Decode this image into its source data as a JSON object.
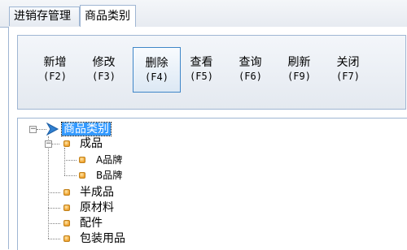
{
  "tabs": [
    {
      "label": "进销存管理",
      "active": false
    },
    {
      "label": "商品类别",
      "active": true
    }
  ],
  "toolbar": {
    "buttons": [
      {
        "label": "新增",
        "key": "(F2)"
      },
      {
        "label": "修改",
        "key": "(F3)"
      },
      {
        "label": "删除",
        "key": "(F4)",
        "active": true
      },
      {
        "label": "查看",
        "key": "(F5)"
      },
      {
        "label": "查询",
        "key": "(F6)"
      },
      {
        "label": "刷新",
        "key": "(F9)"
      },
      {
        "label": "关闭",
        "key": "(F7)"
      }
    ]
  },
  "tree": {
    "root": "商品类别",
    "items": [
      "成品",
      "A品牌",
      "B品牌",
      "半成品",
      "原材料",
      "配件",
      "包装用品"
    ]
  },
  "colors": {
    "selection": "#3399ff",
    "border": "#9fb6d3",
    "active_button_border": "#3f86c8"
  }
}
